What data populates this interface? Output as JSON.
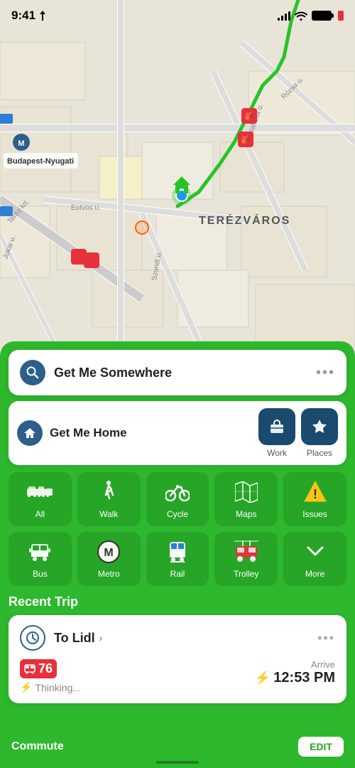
{
  "statusBar": {
    "time": "9:41",
    "hasLocation": true
  },
  "map": {
    "district": "TERÉZVÁROS",
    "station": "Budapest-Nyugati"
  },
  "searchBar": {
    "title": "Get Me Somewhere",
    "moreLabel": "•••"
  },
  "quickActions": {
    "homeLabel": "Get Me Home",
    "workLabel": "Work",
    "placesLabel": "Places"
  },
  "transport": [
    {
      "id": "all",
      "label": "All",
      "icon": "all"
    },
    {
      "id": "walk",
      "label": "Walk",
      "icon": "walk"
    },
    {
      "id": "cycle",
      "label": "Cycle",
      "icon": "cycle"
    },
    {
      "id": "maps",
      "label": "Maps",
      "icon": "maps"
    },
    {
      "id": "issues",
      "label": "Issues",
      "icon": "issues"
    },
    {
      "id": "bus",
      "label": "Bus",
      "icon": "bus"
    },
    {
      "id": "metro",
      "label": "Metro",
      "icon": "metro"
    },
    {
      "id": "rail",
      "label": "Rail",
      "icon": "rail"
    },
    {
      "id": "trolley",
      "label": "Trolley",
      "icon": "trolley"
    },
    {
      "id": "more",
      "label": "More",
      "icon": "more"
    }
  ],
  "recentTrip": {
    "sectionTitle": "Recent Trip",
    "destination": "To Lidl",
    "routeNumber": "76",
    "thinkingText": "Thinking...",
    "arriveLabel": "Arrive",
    "arriveTime": "12:53 PM",
    "dotsLabel": "•••"
  },
  "bottomBar": {
    "commuteLabel": "Commute",
    "editLabel": "EDIT"
  }
}
